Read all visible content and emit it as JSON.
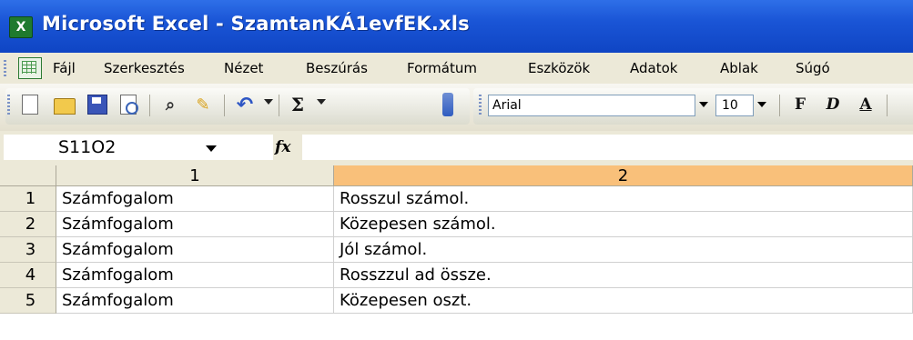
{
  "window": {
    "title": "Microsoft Excel - SzamtanKÁ1evfEK.xls"
  },
  "menu": {
    "items": [
      "Fájl",
      "Szerkesztés",
      "Nézet",
      "Beszúrás",
      "Formátum",
      "Eszközök",
      "Adatok",
      "Ablak",
      "Súgó"
    ]
  },
  "toolbar": {
    "font_name": "Arial",
    "font_size": "10",
    "bold_label": "F",
    "italic_label": "D",
    "underline_label": "A",
    "sum_label": "Σ",
    "icons": [
      "new-icon",
      "open-icon",
      "save-icon",
      "print-preview-icon",
      "research-icon",
      "spelling-icon",
      "undo-icon",
      "autosum-icon"
    ]
  },
  "formula_bar": {
    "name_box": "S11O2",
    "fx_label": "fx",
    "value": ""
  },
  "sheet": {
    "columns": [
      "1",
      "2"
    ],
    "selected_column": "2",
    "rows": [
      {
        "num": "1",
        "a": "Számfogalom",
        "b": "Rosszul számol."
      },
      {
        "num": "2",
        "a": "Számfogalom",
        "b": "Közepesen számol."
      },
      {
        "num": "3",
        "a": "Számfogalom",
        "b": "Jól számol."
      },
      {
        "num": "4",
        "a": "Számfogalom",
        "b": "Rosszzul ad össze."
      },
      {
        "num": "5",
        "a": "Számfogalom",
        "b": "Közepesen oszt."
      }
    ]
  },
  "colors": {
    "title_bar": "#1a55d6",
    "selected_col_header": "#f9c07a",
    "chrome": "#ece9d8"
  }
}
